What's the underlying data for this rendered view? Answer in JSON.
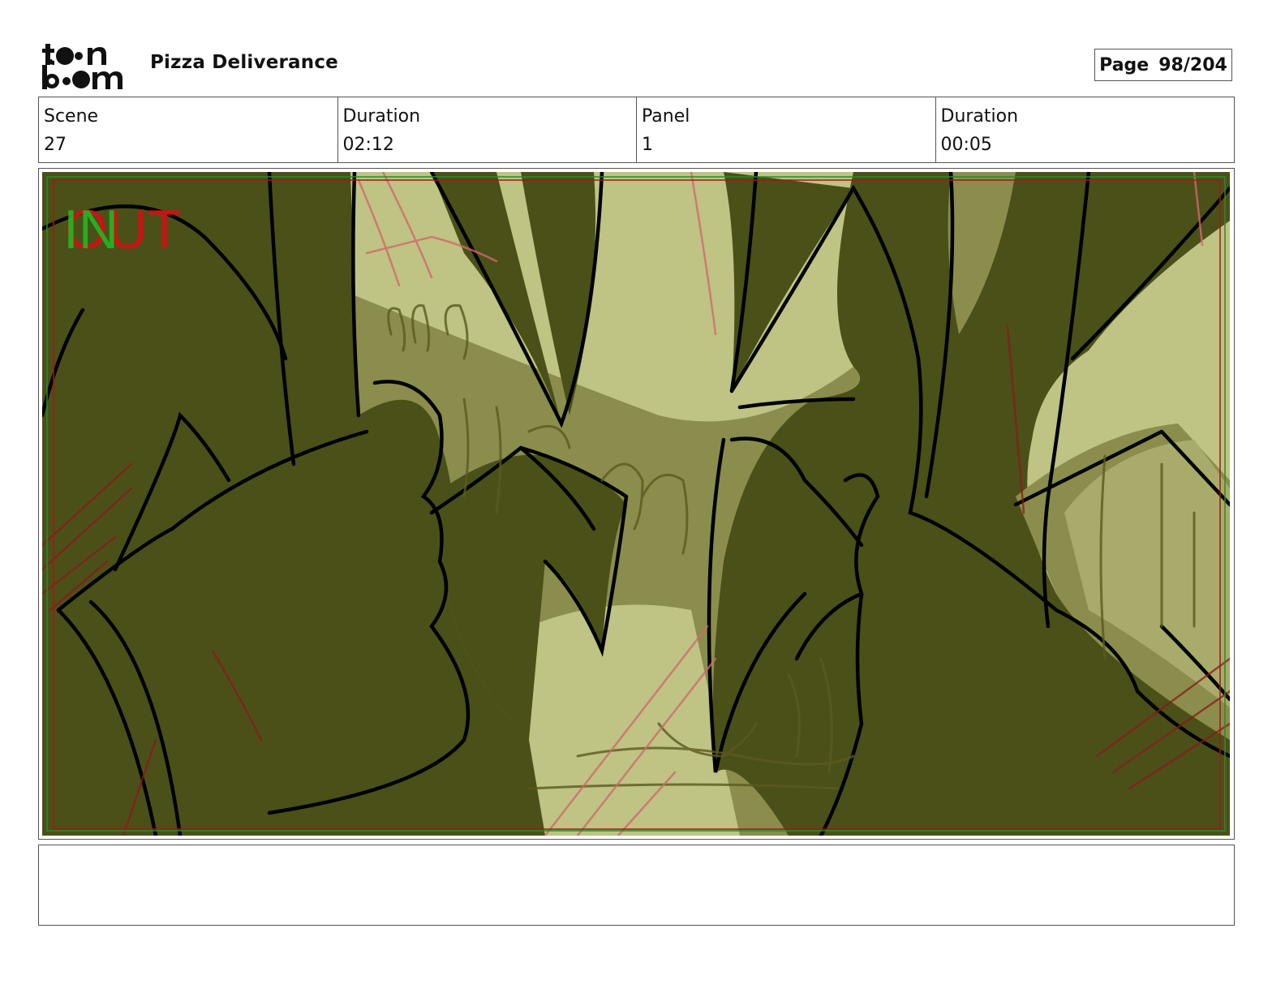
{
  "header": {
    "logo_text": "toon boom",
    "project_title": "Pizza Deliverance",
    "page_label": "Page",
    "page_number": "98/204"
  },
  "info": {
    "scene_label": "Scene",
    "scene_value": "27",
    "scene_duration_label": "Duration",
    "scene_duration_value": "02:12",
    "panel_label": "Panel",
    "panel_value": "1",
    "panel_duration_label": "Duration",
    "panel_duration_value": "00:05"
  },
  "panel": {
    "in_marker": "IN",
    "out_marker": "OUT",
    "colors": {
      "dark_olive": "#4b5018",
      "mid_olive": "#8b8d4c",
      "light_olive": "#bfc383",
      "ink": "#000000",
      "guide_red": "#a01818",
      "guide_green": "#2a8a2a",
      "in_green": "#22b822",
      "out_red": "#c81414"
    }
  },
  "notes": {
    "text": ""
  }
}
